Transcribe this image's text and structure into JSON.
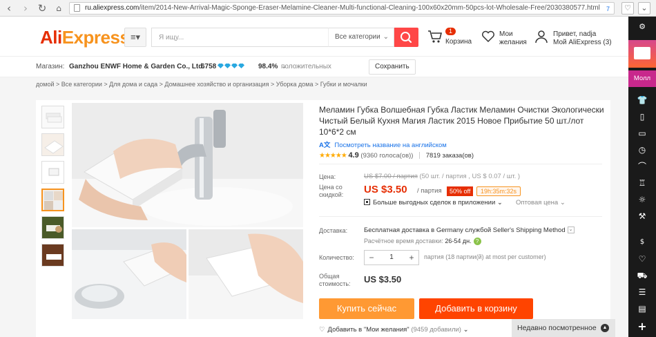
{
  "browser": {
    "url_domain": "ru.aliexpress.com",
    "url_path": "/item/2014-New-Arrival-Magic-Sponge-Eraser-Melamine-Cleaner-Multi-functional-Cleaning-100x60x20mm-50pcs-lot-Wholesale-Free/2030380577.html",
    "ext_badge": "7"
  },
  "header": {
    "logo_part1": "Ali",
    "logo_part2": "Express",
    "search_placeholder": "Я ищу...",
    "search_category": "Все категории",
    "cart_count": "1",
    "cart_label": "Корзина",
    "wishlist_label_1": "Мои",
    "wishlist_label_2": "желания",
    "account_greeting": "Привет, nadja",
    "account_label": "Мой AliExpress (3)"
  },
  "store": {
    "prefix": "Магазин:",
    "name": "Ganzhou ENWF Home & Garden Co., Ltd.",
    "score": "6758",
    "positive": "98.4%",
    "positive_label": "положительных отзывов",
    "save": "Сохранить"
  },
  "breadcrumb": [
    "домой",
    "Все категории",
    "Для дома и сада",
    "Домашнее хозяйство и организация",
    "Уборка дома",
    "Губки и мочалки"
  ],
  "product": {
    "title": "Меламин Губка Волшебная Губка Ластик Меламин Очистки Экологически Чистый Белый Кухня Магия Ластик 2015 Новое Прибытие 50 шт./лот 10*6*2 см",
    "translate_link": "Посмотреть название на английском",
    "rating_stars": "★★★★★",
    "rating_score": "4.9",
    "rating_votes": "(9360 голоса(ов))",
    "orders": "7819 заказа(ов)",
    "price_label": "Цена:",
    "old_price": "US $7.00 / партия",
    "old_price_detail": "(50 шт. / партия , US $ 0.07 / шт. )",
    "discount_price_label_1": "Цена со",
    "discount_price_label_2": "скидкой:",
    "sale_price": "US $3.50",
    "per_lot": "/ партия",
    "discount": "50% off",
    "timer": "19h:35m:32s",
    "app_deals": "Больше выгодных сделок в приложении",
    "wholesale": "Оптовая цена",
    "shipping_label": "Доставка:",
    "shipping_text": "Бесплатная доставка в Germany службой Seller's Shipping Method",
    "delivery_label": "Расчётное время доставки:",
    "delivery_value": "26-54 дн.",
    "quantity_label": "Количество:",
    "quantity": "1",
    "quantity_note": "партия (18 партии(й) at most per customer)",
    "total_label_1": "Общая",
    "total_label_2": "стоимость:",
    "total": "US $3.50",
    "buy_now": "Купить сейчас",
    "add_to_cart": "Добавить в корзину",
    "add_wishlist": "Добавить в \"Мои желания\"",
    "wishlist_count": "(9459 добавили)"
  },
  "recent": {
    "label": "Недавно посмотренное"
  },
  "sidebar": {
    "mall_label": "Молл"
  },
  "colors": {
    "brand_red": "#e62e04",
    "brand_orange": "#f7931e",
    "buy_now": "#ff9933",
    "add_to_cart": "#ff4400"
  }
}
